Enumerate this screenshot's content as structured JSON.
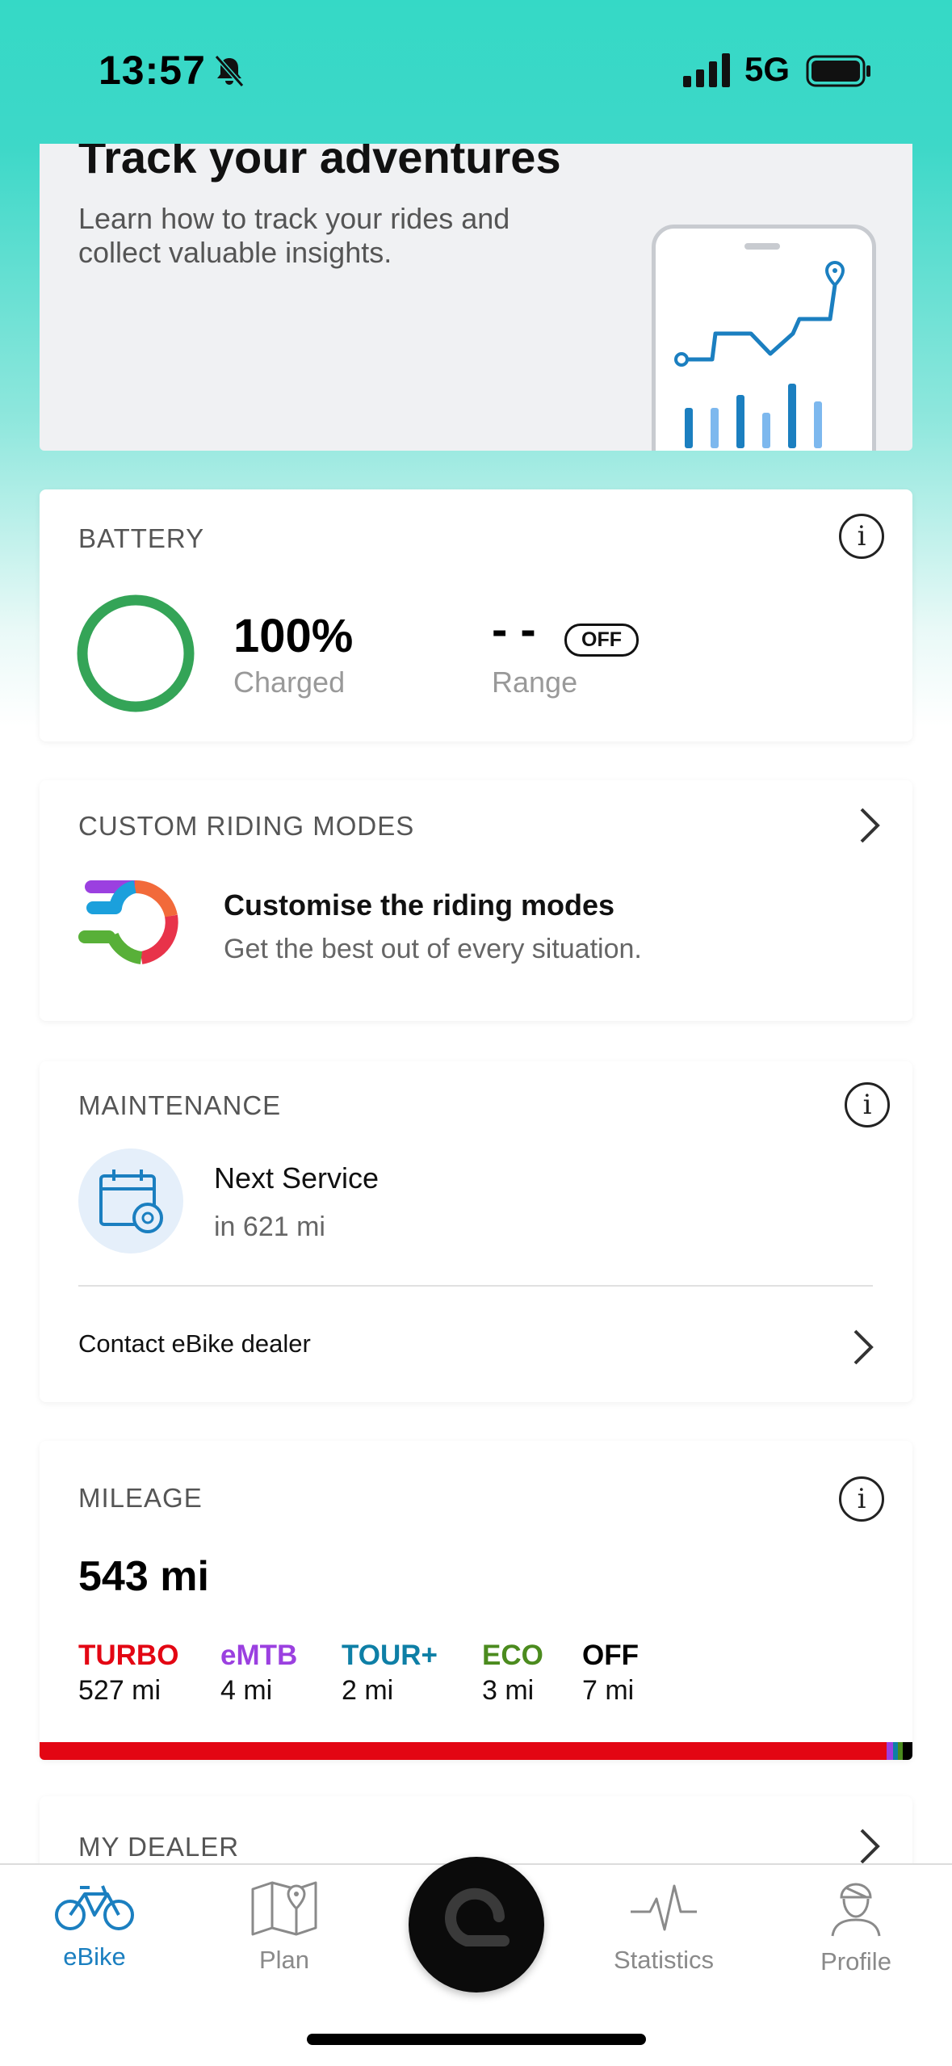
{
  "status_bar": {
    "time": "13:57",
    "network": "5G"
  },
  "promo": {
    "title": "Track your adventures",
    "subtitle": "Learn how to track your rides and collect valuable insights."
  },
  "battery": {
    "label": "BATTERY",
    "percent": "100%",
    "percent_caption": "Charged",
    "range_value": "- -",
    "range_badge": "OFF",
    "range_caption": "Range",
    "charge_level": 1.0,
    "ring_color": "#34a457"
  },
  "riding_modes": {
    "label": "CUSTOM RIDING MODES",
    "title": "Customise the riding modes",
    "subtitle": "Get the best out of every situation."
  },
  "maintenance": {
    "label": "MAINTENANCE",
    "next_service_title": "Next Service",
    "next_service_value": "in 621 mi",
    "contact_link": "Contact eBike dealer"
  },
  "mileage": {
    "label": "MILEAGE",
    "total": "543 mi",
    "modes": [
      {
        "name": "TURBO",
        "distance": "527 mi",
        "color": "#e30613"
      },
      {
        "name": "eMTB",
        "distance": "4 mi",
        "color": "#9b40e0"
      },
      {
        "name": "TOUR+",
        "distance": "2 mi",
        "color": "#0e7fa6"
      },
      {
        "name": "ECO",
        "distance": "3 mi",
        "color": "#4b8b1e"
      },
      {
        "name": "OFF",
        "distance": "7 mi",
        "color": "#000000"
      }
    ]
  },
  "dealer": {
    "label": "MY DEALER"
  },
  "tabbar": {
    "accent": "#1b7fc0",
    "inactive": "#8a8a8a",
    "tabs": [
      {
        "label": "eBike",
        "icon": "bike-icon",
        "active": true
      },
      {
        "label": "Plan",
        "icon": "map-icon",
        "active": false
      },
      {
        "label": "Statistics",
        "icon": "activity-icon",
        "active": false
      },
      {
        "label": "Profile",
        "icon": "rider-icon",
        "active": false
      }
    ]
  }
}
